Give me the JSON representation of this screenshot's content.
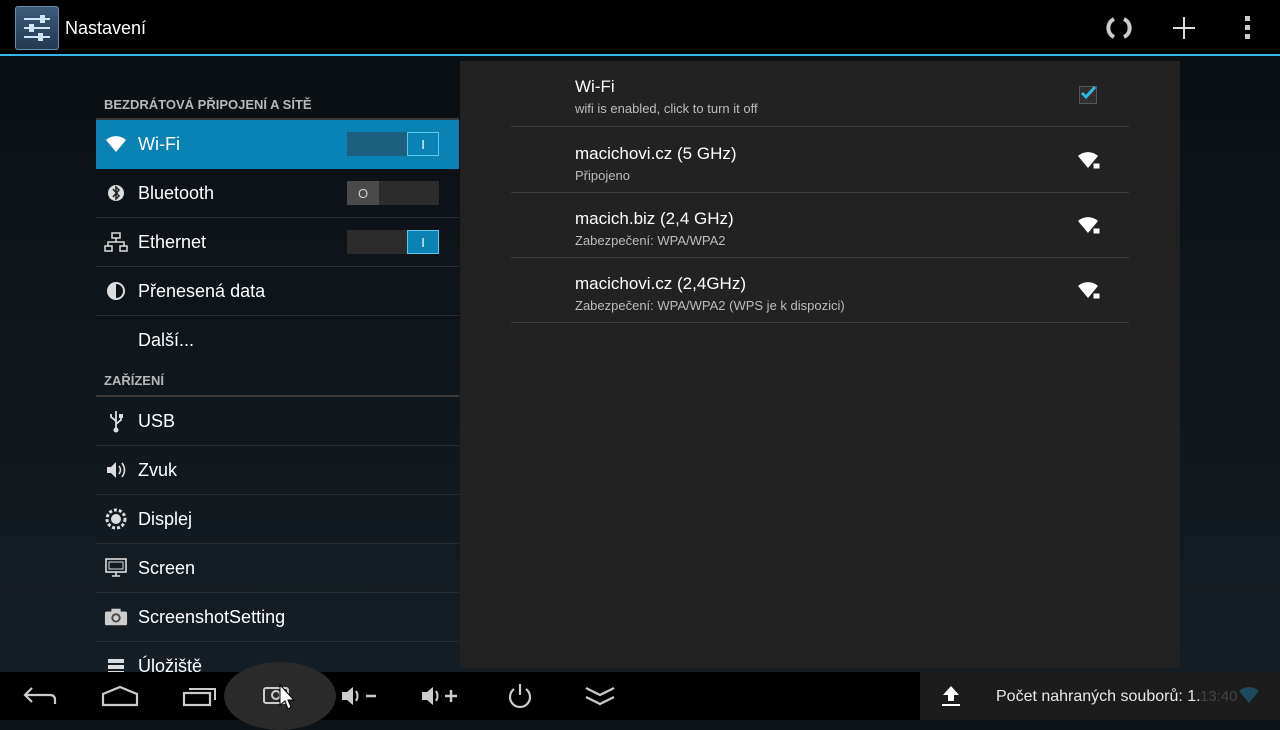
{
  "app": {
    "title": "Nastavení"
  },
  "sections": [
    {
      "header": "BEZDRÁTOVÁ PŘIPOJENÍ A SÍTĚ"
    },
    {
      "header": "ZAŘÍZENÍ"
    }
  ],
  "menu": {
    "wifi": {
      "label": "Wi-Fi",
      "toggle": "I"
    },
    "bluetooth": {
      "label": "Bluetooth",
      "toggle": "O"
    },
    "ethernet": {
      "label": "Ethernet",
      "toggle": "I"
    },
    "data": {
      "label": "Přenesená data"
    },
    "more": {
      "label": "Další..."
    },
    "usb": {
      "label": "USB"
    },
    "sound": {
      "label": "Zvuk"
    },
    "display": {
      "label": "Displej"
    },
    "screen": {
      "label": "Screen"
    },
    "screenshot": {
      "label": "ScreenshotSetting"
    },
    "storage": {
      "label": "Úložiště"
    }
  },
  "wifi_panel": {
    "toggle_title": "Wi-Fi",
    "toggle_sub": "wifi is enabled, click to turn it off",
    "networks": [
      {
        "name": "macichovi.cz (5 GHz)",
        "status": "Připojeno"
      },
      {
        "name": "macich.biz (2,4 GHz)",
        "status": "Zabezpečení: WPA/WPA2"
      },
      {
        "name": "macichovi.cz (2,4GHz)",
        "status": "Zabezpečení: WPA/WPA2 (WPS je k dispozici)"
      }
    ]
  },
  "statusbar": {
    "upload_text": "Počet nahraných souborů: 1.",
    "clock": "13:40"
  },
  "colors": {
    "accent": "#33b5e5",
    "active": "#0a82b4"
  }
}
